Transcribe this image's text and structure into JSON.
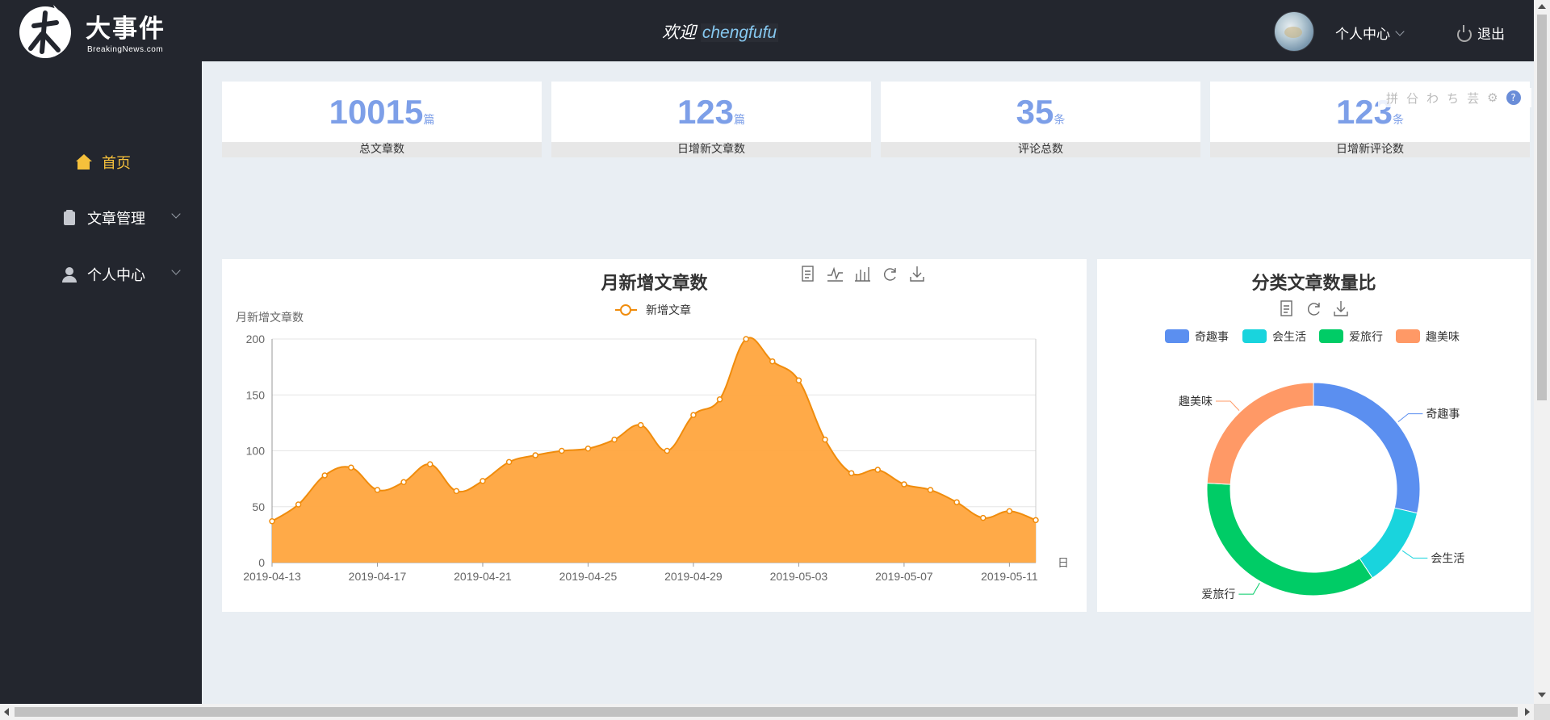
{
  "header": {
    "brand": "大事件",
    "brand_sub": "BreakingNews.com",
    "welcome": "欢迎",
    "username": "chengfufu",
    "personal_center": "个人中心",
    "logout": "退出"
  },
  "sidebar": {
    "items": [
      {
        "label": "首页",
        "icon": "home-icon",
        "active": true
      },
      {
        "label": "文章管理",
        "icon": "clipboard-icon",
        "expandable": true
      },
      {
        "label": "个人中心",
        "icon": "user-icon",
        "expandable": true
      }
    ]
  },
  "stats": [
    {
      "value": "10015",
      "unit": "篇",
      "label": "总文章数"
    },
    {
      "value": "123",
      "unit": "篇",
      "label": "日增新文章数"
    },
    {
      "value": "35",
      "unit": "条",
      "label": "评论总数"
    },
    {
      "value": "123",
      "unit": "条",
      "label": "日增新评论数"
    }
  ],
  "overlay_toolbar": [
    "拼",
    "㕣",
    "わ",
    "ち",
    "芸",
    "⚙",
    "?"
  ],
  "colors": {
    "header_bg": "#23262e",
    "accent_active": "#f5c03b",
    "stat_number": "#7d9fe8",
    "area_fill": "#ffa53e",
    "area_line": "#f08c0c"
  },
  "chart_data": [
    {
      "type": "area",
      "title": "月新增文章数",
      "ylabel": "月新增文章数",
      "xlabel": "日",
      "legend": [
        "新增文章"
      ],
      "legend_position": "top-center",
      "ylim": [
        0,
        200
      ],
      "yticks": [
        0,
        50,
        100,
        150,
        200
      ],
      "x_tick_labels": [
        "2019-04-13",
        "2019-04-17",
        "2019-04-21",
        "2019-04-25",
        "2019-04-29",
        "2019-05-03",
        "2019-05-07",
        "2019-05-11"
      ],
      "x": [
        "2019-04-13",
        "2019-04-14",
        "2019-04-15",
        "2019-04-16",
        "2019-04-17",
        "2019-04-18",
        "2019-04-19",
        "2019-04-20",
        "2019-04-21",
        "2019-04-22",
        "2019-04-23",
        "2019-04-24",
        "2019-04-25",
        "2019-04-26",
        "2019-04-27",
        "2019-04-28",
        "2019-04-29",
        "2019-04-30",
        "2019-05-01",
        "2019-05-02",
        "2019-05-03",
        "2019-05-04",
        "2019-05-05",
        "2019-05-06",
        "2019-05-07",
        "2019-05-08",
        "2019-05-09",
        "2019-05-10",
        "2019-05-11",
        "2019-05-12"
      ],
      "series": [
        {
          "name": "新增文章",
          "values": [
            37,
            52,
            78,
            85,
            65,
            72,
            88,
            64,
            73,
            90,
            96,
            100,
            102,
            110,
            123,
            100,
            132,
            146,
            200,
            180,
            163,
            110,
            80,
            83,
            70,
            65,
            54,
            40,
            46,
            38
          ]
        }
      ],
      "toolbar": [
        "data-view-icon",
        "line-chart-icon",
        "bar-chart-icon",
        "restore-icon",
        "download-icon"
      ]
    },
    {
      "type": "pie",
      "title": "分类文章数量比",
      "donut": true,
      "legend_position": "top-center",
      "categories": [
        "奇趣事",
        "会生活",
        "爱旅行",
        "趣美味"
      ],
      "values": [
        95,
        40,
        117,
        80
      ],
      "colors": [
        "#5b8ff0",
        "#19d4dd",
        "#00cc66",
        "#ff9966"
      ],
      "toolbar": [
        "data-view-icon",
        "restore-icon",
        "download-icon"
      ]
    }
  ]
}
